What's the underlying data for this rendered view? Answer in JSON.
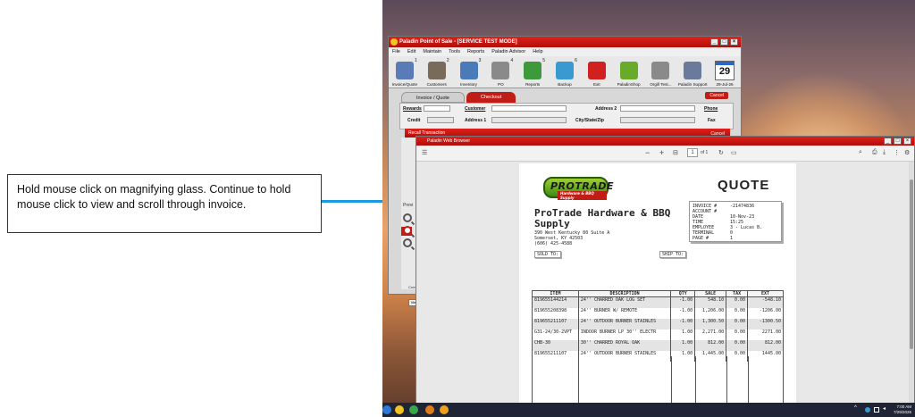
{
  "callout": {
    "text": "Hold mouse click on magnifying glass. Continue to hold mouse click to view and scroll through invoice."
  },
  "pos_window": {
    "title": "Paladin Point of Sale - [SERVICE TEST MODE]",
    "menu": [
      "File",
      "Edit",
      "Maintain",
      "Tools",
      "Reports",
      "Paladin Advisor",
      "Help"
    ],
    "toolbar": [
      {
        "label": "Invoice/Quote",
        "badge": "1",
        "icon": "invoice-icon",
        "color": "#5a7ab8"
      },
      {
        "label": "Customers",
        "badge": "2",
        "icon": "customers-icon",
        "color": "#7a6a5a"
      },
      {
        "label": "Inventory",
        "badge": "3",
        "icon": "inventory-icon",
        "color": "#4a7ab8"
      },
      {
        "label": "PO",
        "badge": "4",
        "icon": "po-icon",
        "color": "#8a8a8a"
      },
      {
        "label": "Reports",
        "badge": "5",
        "icon": "reports-icon",
        "color": "#3c9a3c"
      },
      {
        "label": "Backup",
        "badge": "6",
        "icon": "backup-icon",
        "color": "#3a9ad0"
      },
      {
        "label": "Exit",
        "badge": "",
        "icon": "exit-icon",
        "color": "#d02020"
      },
      {
        "label": "PaladinShop",
        "badge": "",
        "icon": "paladin-shop-icon",
        "color": "#6aaa2a"
      },
      {
        "label": "Orgill Test...",
        "badge": "",
        "icon": "orgill-icon",
        "color": "#8a8a8a"
      },
      {
        "label": "Paladin Support",
        "badge": "",
        "icon": "support-icon",
        "color": "#6a7a9a"
      }
    ],
    "calendar": {
      "month": "JUL",
      "day": "29",
      "label": "29-Jul-26"
    },
    "tabs": {
      "invoice": "Invoice / Quote",
      "checkout": "Checkout"
    },
    "cancel_label": "Cancel",
    "fields": {
      "rewards": "Rewards",
      "customer": "Customer",
      "address2": "Address 2",
      "phone": "Phone",
      "credit": "Credit",
      "address1": "Address 1",
      "city": "City/State/Zip",
      "fax": "Fax"
    },
    "recall": {
      "title": "Recall Transaction",
      "cancel": "Cancel"
    },
    "preview_label": "Previ",
    "view_label": "View",
    "comm_label": "Comm"
  },
  "browser": {
    "title": "Paladin Web Browser",
    "pdf_toolbar": {
      "page": "1",
      "of": "of 1",
      "minus": "−",
      "plus": "+"
    }
  },
  "document": {
    "logo": {
      "main": "PROTRADE",
      "sub": "Hardware & BBQ Supply"
    },
    "title": "QUOTE",
    "info": [
      {
        "k": "INVOICE #",
        "v": "-21474836"
      },
      {
        "k": "ACCOUNT #",
        "v": ""
      },
      {
        "k": "DATE",
        "v": "10-Nov-23"
      },
      {
        "k": "TIME",
        "v": "15:25"
      },
      {
        "k": "EMPLOYEE",
        "v": "3 - Lucas B."
      },
      {
        "k": "TERMINAL",
        "v": "0"
      },
      {
        "k": "PAGE #",
        "v": "1"
      }
    ],
    "company": "ProTrade Hardware & BBQ Supply",
    "address": [
      "390 West Kentucky 80 Suite A",
      "Somerset, KY 42503",
      "(606) 425-4588"
    ],
    "sold_to": "SOLD TO:",
    "ship_to": "SHIP TO:",
    "columns": [
      "ITEM",
      "DESCRIPTION",
      "QTY",
      "SALE",
      "TAX",
      "EXT"
    ],
    "rows": [
      [
        "819655144214",
        "24'' CHARRED OAK LOG SET",
        "-1.00",
        "548.10",
        "0.00",
        "-548.10"
      ],
      [
        "819655208398",
        "24'' BURNER W/ REMOTE",
        "-1.00",
        "1,206.00",
        "0.00",
        "-1206.00"
      ],
      [
        "819655211107",
        "24'' OUTDOOR BURNER STAINLES",
        "-1.00",
        "1,300.50",
        "0.00",
        "-1300.50"
      ],
      [
        "G31-24/30-2VPT",
        "INDOOR BURNER LP 30'' ELECTR",
        "1.00",
        "2,271.00",
        "0.00",
        "2271.00"
      ],
      [
        "CHB-30",
        "30'' CHARRED ROYAL OAK",
        "1.00",
        "812.00",
        "0.00",
        "812.00"
      ],
      [
        "819655211107",
        "24'' OUTDOOR BURNER STAINLES",
        "1.00",
        "1,445.00",
        "0.00",
        "1445.00"
      ]
    ]
  },
  "taskbar": {
    "time": "7:00 AM",
    "date": "7/29/2026"
  }
}
